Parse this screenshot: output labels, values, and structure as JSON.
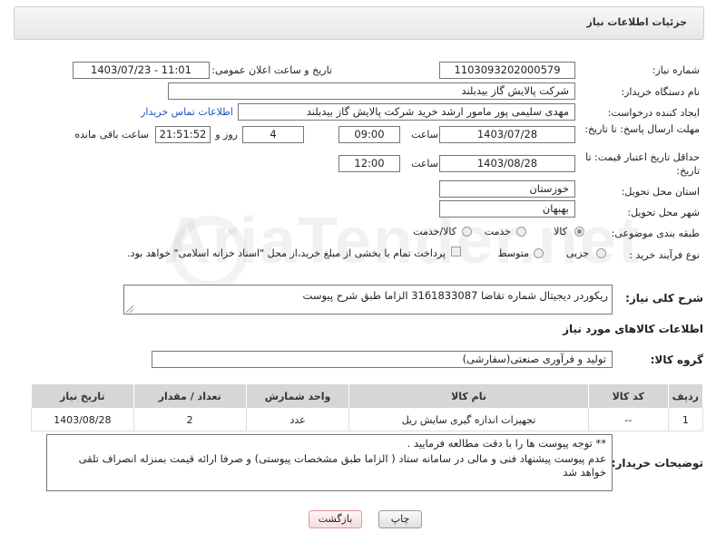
{
  "header": {
    "title": "جزئیات اطلاعات نیاز"
  },
  "form": {
    "need_number_label": "شماره نیاز:",
    "need_number": "1103093202000579",
    "announce_label": "تاریخ و ساعت اعلان عمومی:",
    "announce_value": "1403/07/23 - 11:01",
    "buyer_org_label": "نام دستگاه خریدار:",
    "buyer_org": "شرکت پالایش گاز بیدبلند",
    "creator_label": "ایجاد کننده درخواست:",
    "creator": "مهدی سلیمی پور مامور ارشد خرید شرکت پالایش گاز بیدبلند",
    "contact_link": "اطلاعات تماس خریدار",
    "deadline_label": "مهلت ارسال پاسخ: تا تاریخ:",
    "deadline_date": "1403/07/28",
    "time_label": "ساعت",
    "deadline_time": "09:00",
    "days_value": "4",
    "days_label": "روز و",
    "remaining_time": "21:51:52",
    "remaining_label": "ساعت باقی مانده",
    "validity_label": "حداقل تاریخ اعتبار قیمت: تا تاریخ:",
    "validity_date": "1403/08/28",
    "validity_time": "12:00",
    "province_label": "استان محل تحویل:",
    "province": "خوزستان",
    "city_label": "شهر محل تحویل:",
    "city": "بهبهان",
    "category_label": "طبقه بندی موضوعی:",
    "category_options": [
      "کالا",
      "خدمت",
      "کالا/خدمت"
    ],
    "process_label": "نوع فرآیند خرید :",
    "process_options": [
      "جزیی",
      "متوسط"
    ],
    "payment_note": "پرداخت تمام یا بخشی از مبلغ خرید،از محل \"اسناد خزانه اسلامی\" خواهد بود."
  },
  "description": {
    "label": "شرح کلی نیاز:",
    "text": "ریکوردر دیجیتال  شماره تقاضا 3161833087 الزاما طبق شرح پیوست"
  },
  "goods": {
    "section_title": "اطلاعات کالاهای مورد نیاز",
    "group_label": "گروه کالا:",
    "group_value": "تولید و فرآوری صنعتی(سفارشی)",
    "columns": [
      "ردیف",
      "کد کالا",
      "نام کالا",
      "واحد شمارش",
      "تعداد / مقدار",
      "تاریخ نیاز"
    ],
    "rows": [
      {
        "row": "1",
        "code": "--",
        "name": "تجهیزات اندازه گیری سایش ریل",
        "unit": "عدد",
        "qty": "2",
        "date": "1403/08/28"
      }
    ]
  },
  "notes": {
    "label": "توضیحات خریدار:",
    "line1": "** توجه پیوست ها  را با دقت مطالعه فرمایید .",
    "line2": "عدم پیوست پیشنهاد فنی و مالی در سامانه ستاد ( الزاما طبق مشخصات پیوستی)  و صرفا ارائه قیمت بمنزله انصراف تلقی خواهد شد"
  },
  "buttons": {
    "print": "چاپ",
    "back": "بازگشت"
  },
  "watermark": {
    "text": "AriaTender.net"
  }
}
